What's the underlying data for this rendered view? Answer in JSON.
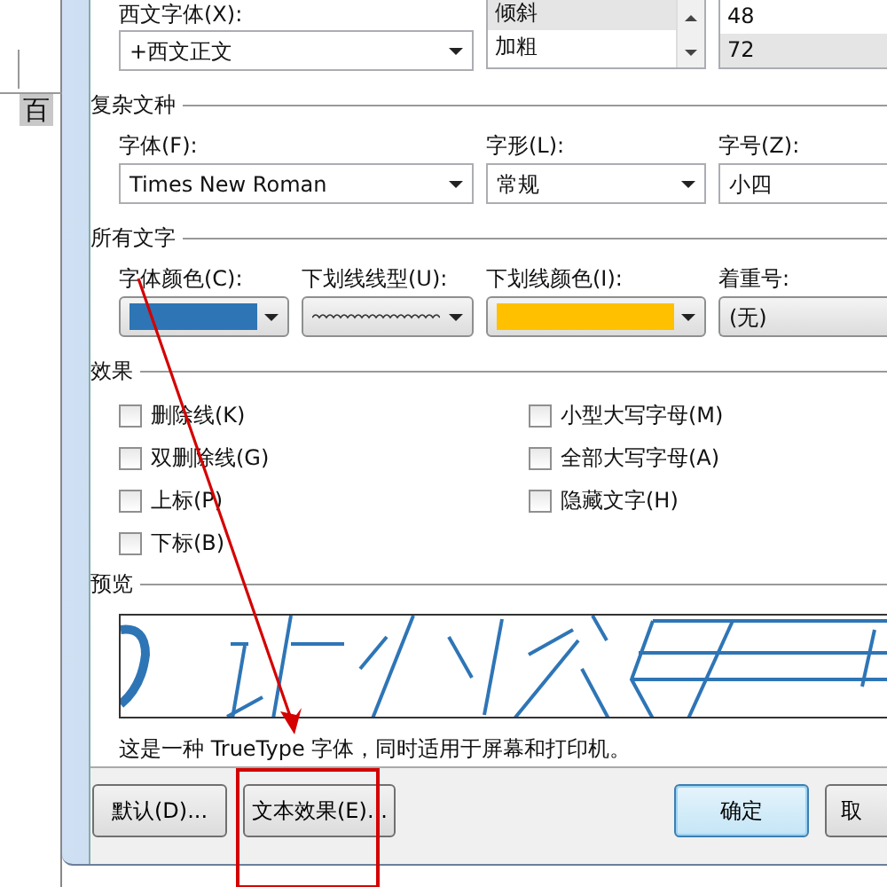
{
  "background_document": {
    "text": "百"
  },
  "western_font": {
    "label": "西文字体(X):",
    "value": "+西文正文"
  },
  "style_list": [
    {
      "label": "倾斜",
      "selected": true
    },
    {
      "label": "加粗",
      "selected": false
    }
  ],
  "size_list": [
    {
      "label": "48",
      "selected": false
    },
    {
      "label": "72",
      "selected": true
    }
  ],
  "complex_script": {
    "title": "复杂文种",
    "fields": [
      {
        "label": "字体(F):",
        "value": "Times New Roman"
      },
      {
        "label": "字形(L):",
        "value": "常规"
      },
      {
        "label": "字号(Z):",
        "value": "小四"
      }
    ]
  },
  "all_text": {
    "title": "所有文字",
    "fields": [
      {
        "kind": "color",
        "label": "字体颜色(C):",
        "color": "#2e75b6"
      },
      {
        "kind": "line",
        "label": "下划线线型(U):"
      },
      {
        "kind": "color",
        "label": "下划线颜色(I):",
        "color": "#ffc000"
      },
      {
        "kind": "text",
        "label": "着重号:",
        "value": "(无)"
      }
    ]
  },
  "effects": {
    "title": "效果",
    "left": [
      {
        "label": "删除线(K)",
        "checked": false
      },
      {
        "label": "双删除线(G)",
        "checked": false
      },
      {
        "label": "上标(P)",
        "checked": false
      },
      {
        "label": "下标(B)",
        "checked": false
      }
    ],
    "right": [
      {
        "label": "小型大写字母(M)",
        "checked": false
      },
      {
        "label": "全部大写字母(A)",
        "checked": false
      },
      {
        "label": "隐藏文字(H)",
        "checked": false
      }
    ]
  },
  "preview": {
    "title": "预览",
    "note": "这是一种 TrueType 字体，同时适用于屏幕和打印机。"
  },
  "buttons_left": [
    {
      "label": "默认(D)...",
      "default": false
    },
    {
      "label": "文本效果(E)...",
      "default": false
    }
  ],
  "buttons_right": [
    {
      "label": "确定",
      "default": true
    },
    {
      "label": "取",
      "default": false
    }
  ]
}
